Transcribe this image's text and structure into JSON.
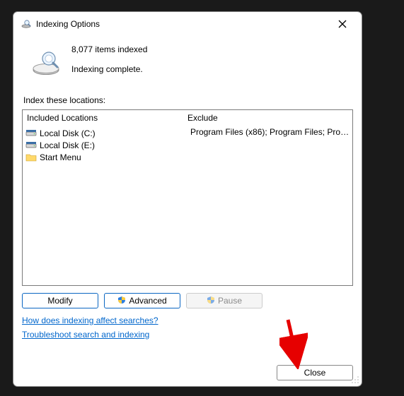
{
  "dialog": {
    "title": "Indexing Options"
  },
  "status": {
    "count_text": "8,077 items indexed",
    "progress_text": "Indexing complete."
  },
  "section_label": "Index these locations:",
  "headers": {
    "included": "Included Locations",
    "exclude": "Exclude"
  },
  "locations": [
    {
      "label": "Local Disk (C:)",
      "icon": "disk",
      "exclude": "Program Files (x86); Program Files; Progra..."
    },
    {
      "label": "Local Disk (E:)",
      "icon": "disk",
      "exclude": ""
    },
    {
      "label": "Start Menu",
      "icon": "folder",
      "exclude": ""
    }
  ],
  "buttons": {
    "modify": "Modify",
    "advanced": "Advanced",
    "pause": "Pause",
    "close": "Close"
  },
  "links": {
    "how": "How does indexing affect searches?",
    "troubleshoot": "Troubleshoot search and indexing"
  }
}
